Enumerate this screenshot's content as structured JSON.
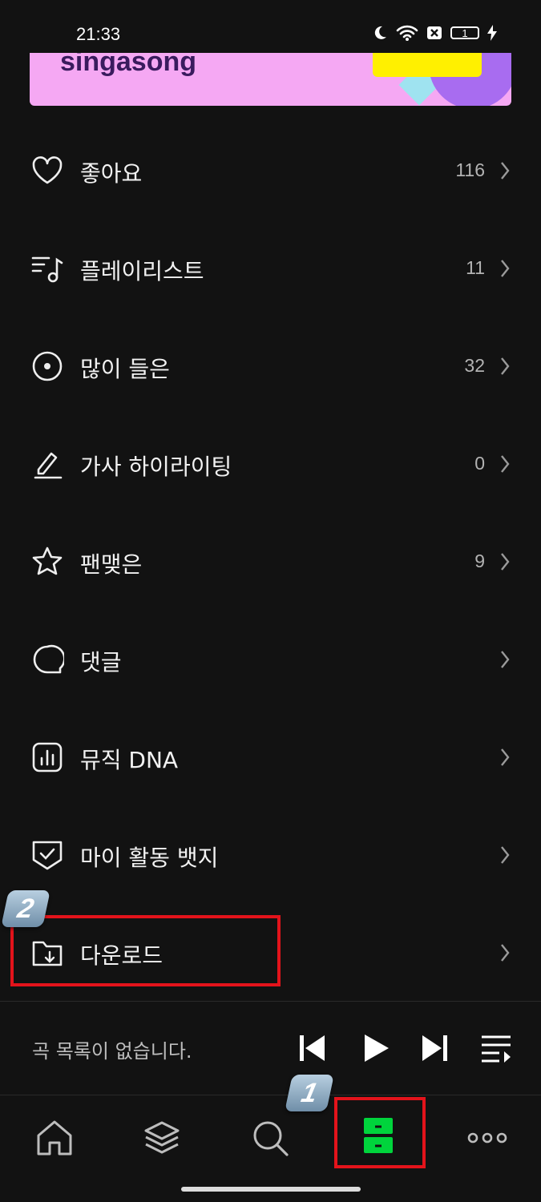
{
  "status_bar": {
    "time": "21:33",
    "battery_level": "1"
  },
  "banner": {
    "text": "singasong"
  },
  "menu": {
    "items": [
      {
        "label": "좋아요",
        "count": "116",
        "icon": "heart-icon"
      },
      {
        "label": "플레이리스트",
        "count": "11",
        "icon": "playlist-icon"
      },
      {
        "label": "많이 들은",
        "count": "32",
        "icon": "disc-icon"
      },
      {
        "label": "가사 하이라이팅",
        "count": "0",
        "icon": "highlight-pen-icon"
      },
      {
        "label": "팬맺은",
        "count": "9",
        "icon": "star-icon"
      },
      {
        "label": "댓글",
        "count": "",
        "icon": "comment-icon"
      },
      {
        "label": "뮤직 DNA",
        "count": "",
        "icon": "chart-icon"
      },
      {
        "label": "마이 활동 뱃지",
        "count": "",
        "icon": "badge-shield-icon"
      },
      {
        "label": "다운로드",
        "count": "",
        "icon": "download-folder-icon"
      }
    ]
  },
  "player": {
    "empty_text": "곡 목록이 없습니다."
  },
  "tabs": [
    "home-icon",
    "layers-icon",
    "search-icon",
    "library-icon",
    "more-icon"
  ],
  "annotations": {
    "badge_1": "1",
    "badge_2": "2"
  },
  "colors": {
    "accent": "#00d43c",
    "annotation": "#e3131b",
    "background": "#121212"
  }
}
